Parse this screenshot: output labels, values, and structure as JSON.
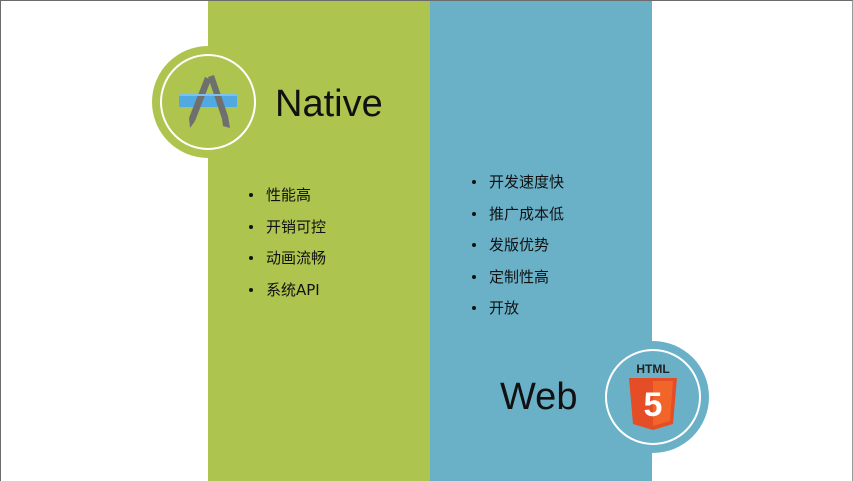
{
  "native": {
    "title": "Native",
    "icon": "app-store-icon",
    "color": "#adc44e",
    "items": [
      "性能高",
      "开销可控",
      "动画流畅",
      "系统API"
    ]
  },
  "web": {
    "title": "Web",
    "icon": "html5-icon",
    "icon_text": "HTML",
    "icon_digit": "5",
    "color": "#6ab1c8",
    "items": [
      "开发速度快",
      "推广成本低",
      "发版优势",
      "定制性高",
      "开放"
    ]
  }
}
